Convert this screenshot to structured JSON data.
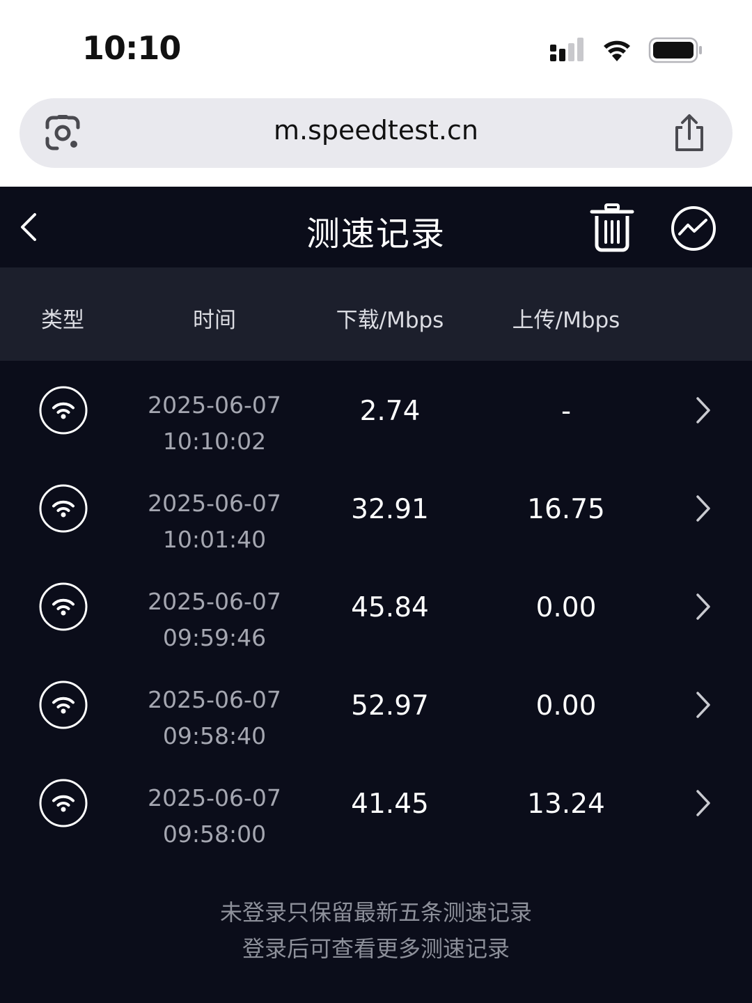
{
  "status_bar": {
    "time": "10:10",
    "icons": [
      "cellular-signal-icon",
      "wifi-icon",
      "battery-icon"
    ]
  },
  "browser": {
    "url": "m.speedtest.cn",
    "icons": [
      "lens-icon",
      "share-icon"
    ]
  },
  "header": {
    "title": "测速记录",
    "icons": [
      "back-icon",
      "trash-icon",
      "chart-icon"
    ]
  },
  "table": {
    "columns": [
      "类型",
      "时间",
      "下载/Mbps",
      "上传/Mbps"
    ],
    "rows": [
      {
        "type_icon": "wifi-icon",
        "date": "2025-06-07",
        "time": "10:10:02",
        "download": "2.74",
        "upload": "-"
      },
      {
        "type_icon": "wifi-icon",
        "date": "2025-06-07",
        "time": "10:01:40",
        "download": "32.91",
        "upload": "16.75"
      },
      {
        "type_icon": "wifi-icon",
        "date": "2025-06-07",
        "time": "09:59:46",
        "download": "45.84",
        "upload": "0.00"
      },
      {
        "type_icon": "wifi-icon",
        "date": "2025-06-07",
        "time": "09:58:40",
        "download": "52.97",
        "upload": "0.00"
      },
      {
        "type_icon": "wifi-icon",
        "date": "2025-06-07",
        "time": "09:58:00",
        "download": "41.45",
        "upload": "13.24"
      }
    ]
  },
  "footer": {
    "line1": "未登录只保留最新五条测速记录",
    "line2": "登录后可查看更多测速记录"
  },
  "colors": {
    "background": "#0b0d1a",
    "table_header": "#1c1f2c",
    "url_bar": "#e9e9ee",
    "muted_text": "#a5a7b1"
  }
}
